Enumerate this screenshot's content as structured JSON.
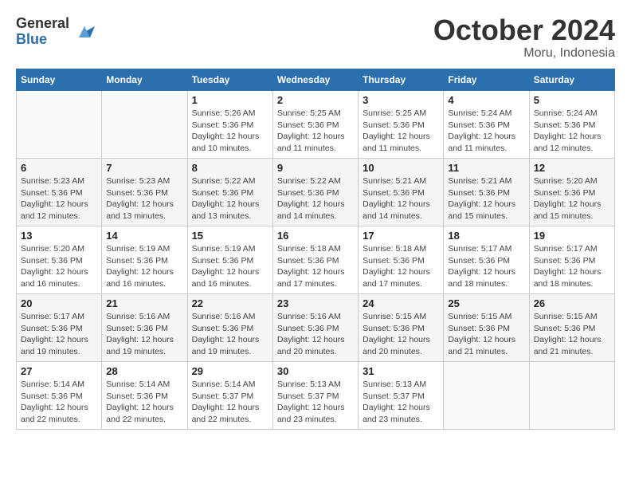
{
  "header": {
    "logo_general": "General",
    "logo_blue": "Blue",
    "month": "October 2024",
    "location": "Moru, Indonesia"
  },
  "days_of_week": [
    "Sunday",
    "Monday",
    "Tuesday",
    "Wednesday",
    "Thursday",
    "Friday",
    "Saturday"
  ],
  "weeks": [
    [
      {
        "day": "",
        "info": ""
      },
      {
        "day": "",
        "info": ""
      },
      {
        "day": "1",
        "info": "Sunrise: 5:26 AM\nSunset: 5:36 PM\nDaylight: 12 hours and 10 minutes."
      },
      {
        "day": "2",
        "info": "Sunrise: 5:25 AM\nSunset: 5:36 PM\nDaylight: 12 hours and 11 minutes."
      },
      {
        "day": "3",
        "info": "Sunrise: 5:25 AM\nSunset: 5:36 PM\nDaylight: 12 hours and 11 minutes."
      },
      {
        "day": "4",
        "info": "Sunrise: 5:24 AM\nSunset: 5:36 PM\nDaylight: 12 hours and 11 minutes."
      },
      {
        "day": "5",
        "info": "Sunrise: 5:24 AM\nSunset: 5:36 PM\nDaylight: 12 hours and 12 minutes."
      }
    ],
    [
      {
        "day": "6",
        "info": "Sunrise: 5:23 AM\nSunset: 5:36 PM\nDaylight: 12 hours and 12 minutes."
      },
      {
        "day": "7",
        "info": "Sunrise: 5:23 AM\nSunset: 5:36 PM\nDaylight: 12 hours and 13 minutes."
      },
      {
        "day": "8",
        "info": "Sunrise: 5:22 AM\nSunset: 5:36 PM\nDaylight: 12 hours and 13 minutes."
      },
      {
        "day": "9",
        "info": "Sunrise: 5:22 AM\nSunset: 5:36 PM\nDaylight: 12 hours and 14 minutes."
      },
      {
        "day": "10",
        "info": "Sunrise: 5:21 AM\nSunset: 5:36 PM\nDaylight: 12 hours and 14 minutes."
      },
      {
        "day": "11",
        "info": "Sunrise: 5:21 AM\nSunset: 5:36 PM\nDaylight: 12 hours and 15 minutes."
      },
      {
        "day": "12",
        "info": "Sunrise: 5:20 AM\nSunset: 5:36 PM\nDaylight: 12 hours and 15 minutes."
      }
    ],
    [
      {
        "day": "13",
        "info": "Sunrise: 5:20 AM\nSunset: 5:36 PM\nDaylight: 12 hours and 16 minutes."
      },
      {
        "day": "14",
        "info": "Sunrise: 5:19 AM\nSunset: 5:36 PM\nDaylight: 12 hours and 16 minutes."
      },
      {
        "day": "15",
        "info": "Sunrise: 5:19 AM\nSunset: 5:36 PM\nDaylight: 12 hours and 16 minutes."
      },
      {
        "day": "16",
        "info": "Sunrise: 5:18 AM\nSunset: 5:36 PM\nDaylight: 12 hours and 17 minutes."
      },
      {
        "day": "17",
        "info": "Sunrise: 5:18 AM\nSunset: 5:36 PM\nDaylight: 12 hours and 17 minutes."
      },
      {
        "day": "18",
        "info": "Sunrise: 5:17 AM\nSunset: 5:36 PM\nDaylight: 12 hours and 18 minutes."
      },
      {
        "day": "19",
        "info": "Sunrise: 5:17 AM\nSunset: 5:36 PM\nDaylight: 12 hours and 18 minutes."
      }
    ],
    [
      {
        "day": "20",
        "info": "Sunrise: 5:17 AM\nSunset: 5:36 PM\nDaylight: 12 hours and 19 minutes."
      },
      {
        "day": "21",
        "info": "Sunrise: 5:16 AM\nSunset: 5:36 PM\nDaylight: 12 hours and 19 minutes."
      },
      {
        "day": "22",
        "info": "Sunrise: 5:16 AM\nSunset: 5:36 PM\nDaylight: 12 hours and 19 minutes."
      },
      {
        "day": "23",
        "info": "Sunrise: 5:16 AM\nSunset: 5:36 PM\nDaylight: 12 hours and 20 minutes."
      },
      {
        "day": "24",
        "info": "Sunrise: 5:15 AM\nSunset: 5:36 PM\nDaylight: 12 hours and 20 minutes."
      },
      {
        "day": "25",
        "info": "Sunrise: 5:15 AM\nSunset: 5:36 PM\nDaylight: 12 hours and 21 minutes."
      },
      {
        "day": "26",
        "info": "Sunrise: 5:15 AM\nSunset: 5:36 PM\nDaylight: 12 hours and 21 minutes."
      }
    ],
    [
      {
        "day": "27",
        "info": "Sunrise: 5:14 AM\nSunset: 5:36 PM\nDaylight: 12 hours and 22 minutes."
      },
      {
        "day": "28",
        "info": "Sunrise: 5:14 AM\nSunset: 5:36 PM\nDaylight: 12 hours and 22 minutes."
      },
      {
        "day": "29",
        "info": "Sunrise: 5:14 AM\nSunset: 5:37 PM\nDaylight: 12 hours and 22 minutes."
      },
      {
        "day": "30",
        "info": "Sunrise: 5:13 AM\nSunset: 5:37 PM\nDaylight: 12 hours and 23 minutes."
      },
      {
        "day": "31",
        "info": "Sunrise: 5:13 AM\nSunset: 5:37 PM\nDaylight: 12 hours and 23 minutes."
      },
      {
        "day": "",
        "info": ""
      },
      {
        "day": "",
        "info": ""
      }
    ]
  ]
}
